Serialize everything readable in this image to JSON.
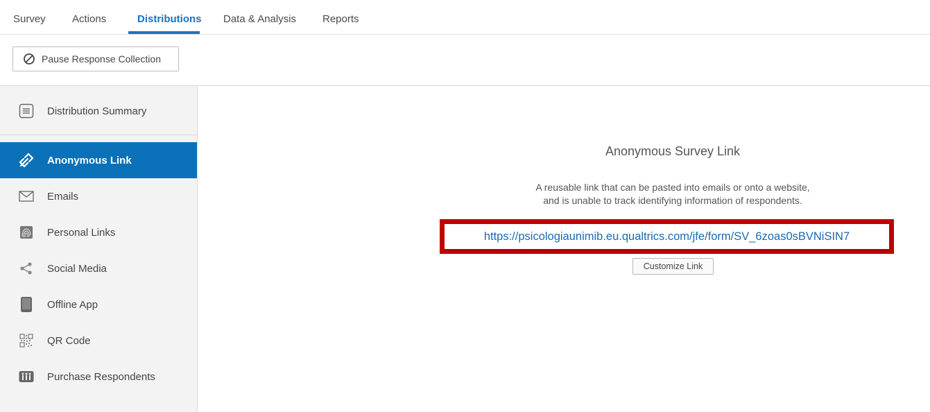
{
  "tabs": [
    {
      "label": "Survey"
    },
    {
      "label": "Actions"
    },
    {
      "label": "Distributions",
      "active": true
    },
    {
      "label": "Data & Analysis"
    },
    {
      "label": "Reports"
    }
  ],
  "toolbar": {
    "pause_label": "Pause Response Collection",
    "pause_icon": "block-icon"
  },
  "sidebar": {
    "items": [
      {
        "label": "Distribution Summary",
        "icon": "list-icon"
      },
      {
        "label": "Anonymous Link",
        "icon": "link-icon",
        "active": true
      },
      {
        "label": "Emails",
        "icon": "envelope-icon"
      },
      {
        "label": "Personal Links",
        "icon": "fingerprint-icon"
      },
      {
        "label": "Social Media",
        "icon": "share-icon"
      },
      {
        "label": "Offline App",
        "icon": "tablet-icon"
      },
      {
        "label": "QR Code",
        "icon": "qr-code-icon"
      },
      {
        "label": "Purchase Respondents",
        "icon": "people-icon"
      }
    ]
  },
  "main": {
    "title": "Anonymous Survey Link",
    "description_line1": "A reusable link that can be pasted into emails or onto a website,",
    "description_line2": "and is unable to track identifying information of respondents.",
    "survey_link": "https://psicologiaunimib.eu.qualtrics.com/jfe/form/SV_6zoas0sBVNiSIN7",
    "customize_label": "Customize Link"
  },
  "colors": {
    "accent": "#1a73c2",
    "active_bg": "#0a71b8",
    "highlight_border": "#c00000",
    "link": "#1a6ab3"
  }
}
